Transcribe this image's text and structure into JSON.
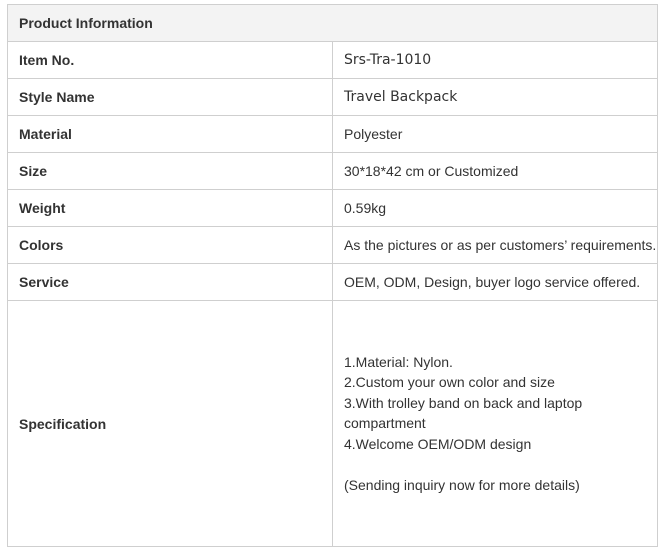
{
  "table": {
    "title": "Product Information",
    "rows": [
      {
        "label": "Item No.",
        "value": "Srs-Tra-1010"
      },
      {
        "label": "Style Name",
        "value": "Travel Backpack"
      },
      {
        "label": "Material",
        "value": "Polyester"
      },
      {
        "label": "Size",
        "value": "30*18*42 cm or Customized"
      },
      {
        "label": "Weight",
        "value": "0.59kg"
      },
      {
        "label": "Colors",
        "value": "As the pictures or as per customers’ requirements."
      },
      {
        "label": "Service",
        "value": "OEM, ODM, Design, buyer logo service offered."
      }
    ],
    "specification": {
      "label": "Specification",
      "lines": [
        "1.Material: Nylon.",
        "2.Custom your own color and size",
        "3.With trolley band on back and laptop compartment",
        "4.Welcome OEM/ODM design"
      ],
      "note": "(Sending inquiry now for more details)"
    }
  }
}
